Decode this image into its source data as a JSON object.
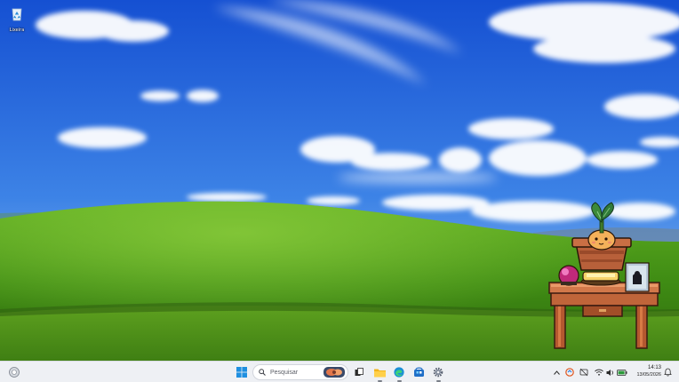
{
  "desktop": {
    "icons": [
      {
        "label": "Lixeira",
        "icon": "recycle-bin-icon"
      }
    ]
  },
  "taskbar": {
    "search": {
      "placeholder": "Pesquisar"
    },
    "pinned": [
      {
        "name": "start",
        "icon": "windows-logo-icon"
      },
      {
        "name": "task-view",
        "icon": "task-view-icon"
      },
      {
        "name": "file-explorer",
        "icon": "folder-icon"
      },
      {
        "name": "edge",
        "icon": "edge-browser-icon"
      },
      {
        "name": "store",
        "icon": "store-icon"
      },
      {
        "name": "settings",
        "icon": "gear-icon"
      }
    ],
    "tray": {
      "icons": [
        "chevron-up-icon",
        "onedrive-icon",
        "bluetooth-off-icon",
        "wifi-icon",
        "volume-icon",
        "battery-icon"
      ],
      "time": "14:13",
      "date": "13/05/2026"
    }
  },
  "colors": {
    "taskbar_bg": "#eef0f4",
    "sky_top": "#1856d6",
    "sky_bottom": "#7fb2ee",
    "hill": "#4f9a1c",
    "accent": "#0078d4"
  }
}
